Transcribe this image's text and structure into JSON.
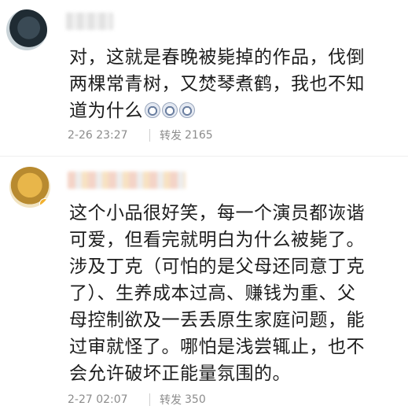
{
  "comments": [
    {
      "text": "对，这就是春晚被毙掉的作品，伐倒\n两棵常青树，又焚琴煮鹤，我也不知\n道为什么",
      "emoji_icons": [
        "dog-face-icon",
        "dog-face-icon",
        "dog-face-icon"
      ],
      "time": "2-26 23:27",
      "repost_label": "转发",
      "repost_count": "2165"
    },
    {
      "text": "这个小品很好笑，每一个演员都诙谐\n可爱，但看完就明白为什么被毙了。\n涉及丁克（可怕的是父母还同意丁克\n了）、生养成本过高、赚钱为重、父\n母控制欲及一丢丢原生家庭问题，能\n过审就怪了。哪怕是浅尝辄止，也不\n会允许破坏正能量氛围的。",
      "time": "2-27 02:07",
      "repost_label": "转发",
      "repost_count": "350"
    }
  ]
}
